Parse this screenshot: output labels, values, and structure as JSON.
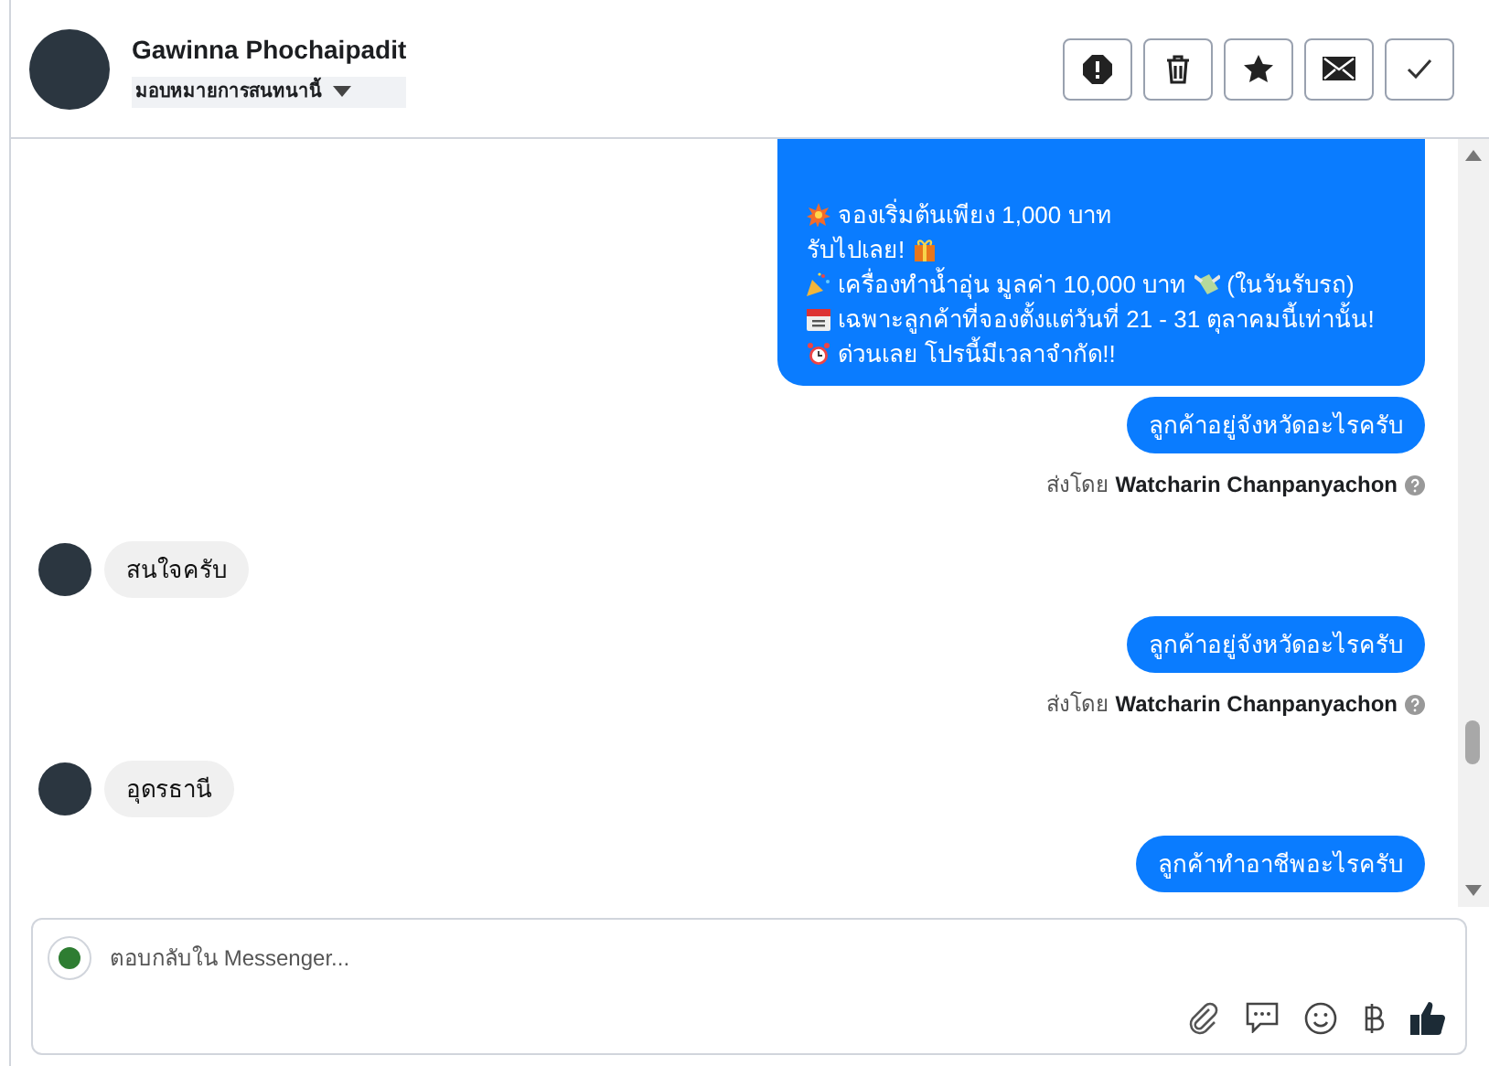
{
  "header": {
    "name": "Gawinna Phochaipadit",
    "assign": "มอบหมายการสนทนานี้"
  },
  "messages": [
    {
      "kind": "outgoing",
      "lines": [
        [
          {
            "kind": "burst"
          },
          {
            "kind": "text",
            "text": "จองเริ่มต้นเพียง 1,000 บาท"
          }
        ],
        [
          {
            "kind": "text",
            "text": "รับไปเลย!"
          },
          {
            "kind": "gift"
          }
        ],
        [
          {
            "kind": "party"
          },
          {
            "kind": "text",
            "text": "เครื่องทำน้ำอุ่น มูลค่า 10,000 บาท"
          },
          {
            "kind": "money"
          },
          {
            "kind": "text",
            "text": "(ในวันรับรถ)"
          }
        ],
        [
          {
            "kind": "calendar"
          },
          {
            "kind": "text",
            "text": "เฉพาะลูกค้าที่จองตั้งแต่วันที่ 21 - 31 ตุลาคมนี้เท่านั้น!"
          }
        ],
        [
          {
            "kind": "alarm"
          },
          {
            "kind": "text",
            "text": "ด่วนเลย โปรนี้มีเวลาจำกัด!!"
          }
        ]
      ]
    },
    {
      "kind": "outgoing",
      "lines": [
        [
          {
            "kind": "text",
            "text": "ลูกค้าอยู่จังหวัดอะไรครับ"
          }
        ]
      ],
      "sent_by_label": "ส่งโดย",
      "sent_by": "Watcharin Chanpanyachon"
    },
    {
      "kind": "incoming",
      "lines": [
        [
          {
            "kind": "text",
            "text": "สนใจครับ"
          }
        ]
      ]
    },
    {
      "kind": "outgoing",
      "lines": [
        [
          {
            "kind": "text",
            "text": "ลูกค้าอยู่จังหวัดอะไรครับ"
          }
        ]
      ],
      "sent_by_label": "ส่งโดย",
      "sent_by": "Watcharin Chanpanyachon"
    },
    {
      "kind": "incoming",
      "lines": [
        [
          {
            "kind": "text",
            "text": "อุดรธานี"
          }
        ]
      ]
    },
    {
      "kind": "outgoing",
      "lines": [
        [
          {
            "kind": "text",
            "text": "ลูกค้าทำอาชีพอะไรครับ"
          }
        ]
      ]
    }
  ],
  "composer": {
    "placeholder": "ตอบกลับใน Messenger..."
  }
}
